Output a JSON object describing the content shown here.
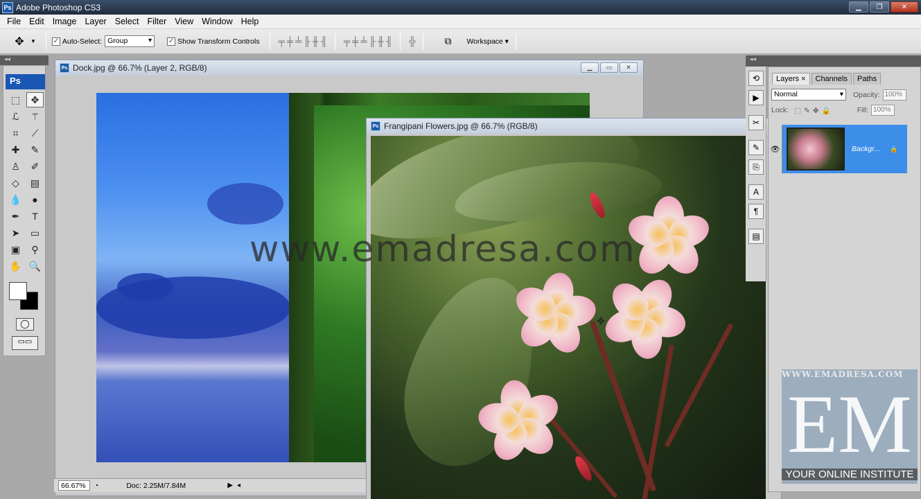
{
  "app": {
    "title": "Adobe Photoshop CS3",
    "icon_label": "Ps"
  },
  "window_controls": [
    "minimize",
    "maximize",
    "close"
  ],
  "menu": [
    "File",
    "Edit",
    "Image",
    "Layer",
    "Select",
    "Filter",
    "View",
    "Window",
    "Help"
  ],
  "options": {
    "auto_select_label": "Auto-Select:",
    "auto_select_checked": true,
    "auto_select_mode": "Group",
    "show_transform_label": "Show Transform Controls",
    "show_transform_checked": true,
    "workspace_label": "Workspace ▾"
  },
  "tools": {
    "ps_logo": "Ps",
    "items": [
      "marquee-icon",
      "move-icon",
      "lasso-icon",
      "magic-wand-icon",
      "crop-icon",
      "slice-icon",
      "healing-icon",
      "brush-icon",
      "stamp-icon",
      "history-brush-icon",
      "eraser-icon",
      "gradient-icon",
      "blur-icon",
      "dodge-icon",
      "pen-icon",
      "type-icon",
      "path-select-icon",
      "shape-icon",
      "notes-icon",
      "eyedropper-icon",
      "hand-icon",
      "zoom-icon"
    ],
    "foreground_color": "#ffffff",
    "background_color": "#000000"
  },
  "doc1": {
    "title": "Dock.jpg @ 66.7% (Layer 2, RGB/8)"
  },
  "doc2": {
    "title": "Frangipani Flowers.jpg @ 66.7% (RGB/8)"
  },
  "status": {
    "zoom": "66.67%",
    "doc_size": "Doc: 2.25M/7.84M"
  },
  "watermark": "www.emadresa.com",
  "layers_panel": {
    "tabs": [
      "Layers ×",
      "Channels",
      "Paths"
    ],
    "blend_mode": "Normal",
    "opacity_label": "Opacity:",
    "opacity": "100%",
    "lock_label": "Lock:",
    "fill_label": "Fill:",
    "fill": "100%",
    "layer_name": "Backgr..."
  },
  "logo": {
    "top": "WWW.EMADRESA.COM",
    "letters": "EM",
    "bottom": "YOUR ONLINE INSTITUTE"
  }
}
